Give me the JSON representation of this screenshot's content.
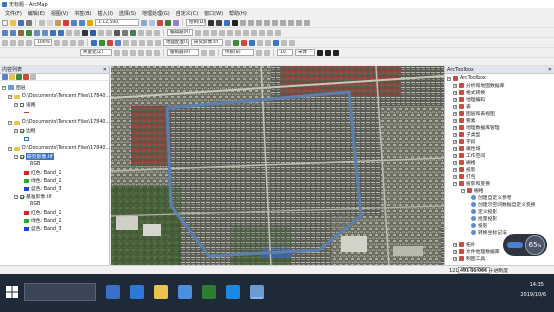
{
  "window": {
    "title": "无标题 - ArcMap"
  },
  "menu": [
    "文件(F)",
    "编辑(E)",
    "视图(V)",
    "书签(B)",
    "插入(I)",
    "选择(S)",
    "地理处理(G)",
    "自定义(C)",
    "窗口(W)",
    "帮助(H)"
  ],
  "toolbar": {
    "scale": "1:12,500",
    "zoom_percent": "100%",
    "editor_label": "编辑器(R)",
    "georef_label": "地理配准(G)",
    "georef_layer": "研究影像.tif",
    "label_weight": "失量化(Z)",
    "draw_label": "绘制(D)",
    "font_size": "10",
    "font_name": "宋体",
    "mapping_label": "缓制器(R)",
    "network_label": "传统(B)"
  },
  "toc": {
    "title": "内容列表",
    "items": [
      {
        "label": "图层",
        "type": "group"
      },
      {
        "label": "D:\\Documents\\Tencent Files\\17840…",
        "type": "folder"
      },
      {
        "label": "道路",
        "type": "layer",
        "color": "#c0392b"
      },
      {
        "label": "D:\\Documents\\Tencent Files\\17840…",
        "type": "folder"
      },
      {
        "label": "边框",
        "type": "layer",
        "color": "#3a6fd0"
      },
      {
        "label": "D:\\Documents\\Tencent Files\\17840…",
        "type": "folder"
      },
      {
        "label": "研究影像.tif",
        "type": "raster"
      },
      {
        "label": "RGB",
        "type": "subhead"
      },
      {
        "label": "红色: Band_1",
        "type": "band",
        "color": "#e02020"
      },
      {
        "label": "绿色: Band_2",
        "type": "band",
        "color": "#20b020"
      },
      {
        "label": "蓝色: Band_3",
        "type": "band",
        "color": "#2040e0"
      },
      {
        "label": "基准影像.tif",
        "type": "raster"
      },
      {
        "label": "RGB",
        "type": "subhead"
      },
      {
        "label": "红色: Band_1",
        "type": "band",
        "color": "#e02020"
      },
      {
        "label": "绿色: Band_2",
        "type": "band",
        "color": "#20b020"
      },
      {
        "label": "蓝色: Band_3",
        "type": "band",
        "color": "#2040e0"
      }
    ]
  },
  "arctoolbox": {
    "title": "ArcToolbox",
    "items": [
      {
        "label": "ArcToolbox",
        "depth": 0,
        "kind": "box"
      },
      {
        "label": "分析和地图数据库",
        "depth": 1,
        "kind": "box"
      },
      {
        "label": "格式转换",
        "depth": 1,
        "kind": "box"
      },
      {
        "label": "地理编码",
        "depth": 1,
        "kind": "box"
      },
      {
        "label": "表",
        "depth": 1,
        "kind": "box"
      },
      {
        "label": "图层和表视图",
        "depth": 1,
        "kind": "box"
      },
      {
        "label": "要素",
        "depth": 1,
        "kind": "box"
      },
      {
        "label": "地理数据库管理",
        "depth": 1,
        "kind": "box"
      },
      {
        "label": "子类型",
        "depth": 1,
        "kind": "box"
      },
      {
        "label": "字段",
        "depth": 1,
        "kind": "box"
      },
      {
        "label": "属性域",
        "depth": 1,
        "kind": "box"
      },
      {
        "label": "工作空间",
        "depth": 1,
        "kind": "box"
      },
      {
        "label": "栅格",
        "depth": 1,
        "kind": "box"
      },
      {
        "label": "投影",
        "depth": 1,
        "kind": "box"
      },
      {
        "label": "打包",
        "depth": 1,
        "kind": "box"
      },
      {
        "label": "投影和变换",
        "depth": 1,
        "kind": "box"
      },
      {
        "label": "栅格",
        "depth": 2,
        "kind": "box"
      },
      {
        "label": "创建自定义参考",
        "depth": 3,
        "kind": "tool"
      },
      {
        "label": "创建示空间数据自定义变换",
        "depth": 3,
        "kind": "tool"
      },
      {
        "label": "定义投影",
        "depth": 3,
        "kind": "tool"
      },
      {
        "label": "批量投影",
        "depth": 3,
        "kind": "tool"
      },
      {
        "label": "投影",
        "depth": 3,
        "kind": "tool"
      },
      {
        "label": "转换坐标记法",
        "depth": 3,
        "kind": "tool"
      },
      {
        "label": "拓扑",
        "depth": 1,
        "kind": "box"
      },
      {
        "label": "文件地理数据库",
        "depth": 1,
        "kind": "box"
      },
      {
        "label": "制图工具",
        "depth": 1,
        "kind": "box"
      }
    ]
  },
  "status": {
    "coords": "121.401 31.066 十进制度",
    "toolbox_tab": "ArcToolbox"
  },
  "speed_widget": {
    "value": "65",
    "unit": "%"
  },
  "tray": {
    "time": "14:35",
    "date": "2019/10/6"
  },
  "colors": {
    "taskbar": "#1f2a38",
    "accent": "#4a7fd4",
    "boundary": "#5a7fb0"
  }
}
